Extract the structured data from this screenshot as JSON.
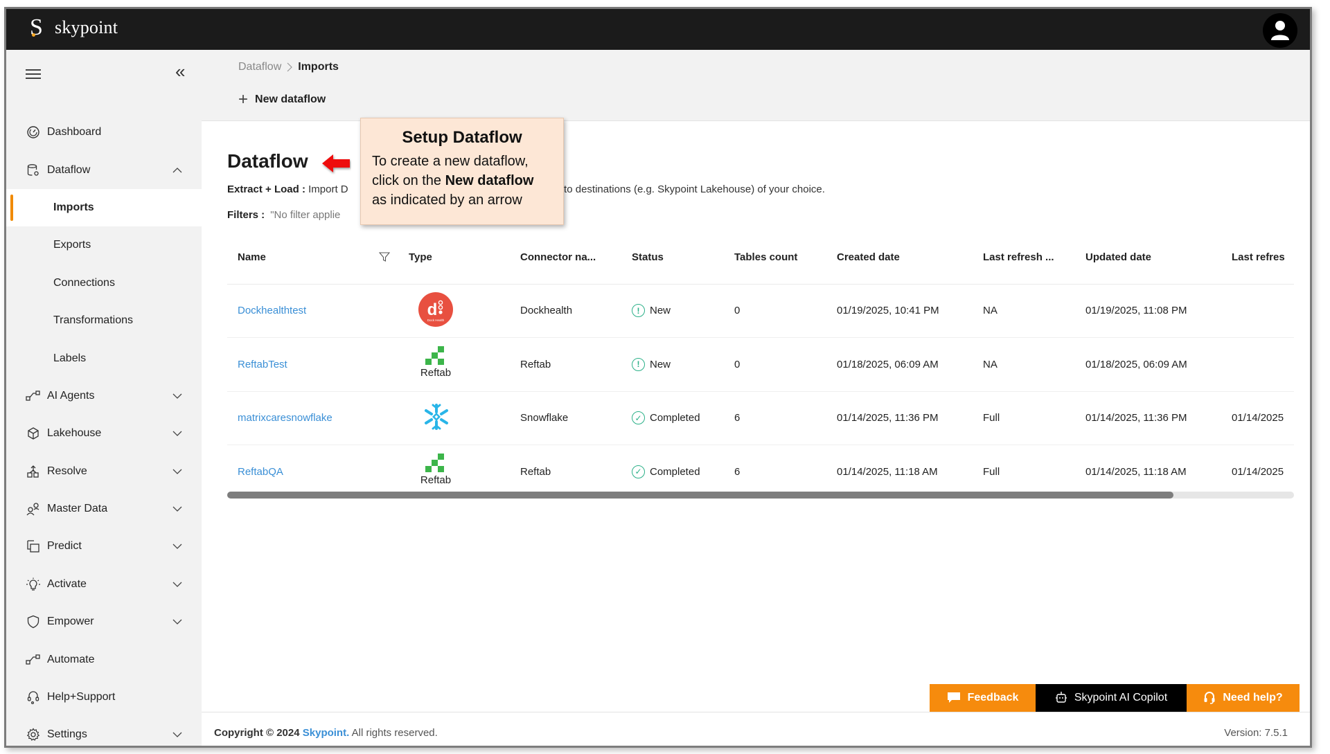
{
  "app": {
    "brand": "skypoint",
    "logo_letter": "S"
  },
  "colors": {
    "accent": "#f68b0d",
    "link": "#3a8fd6",
    "topbar": "#1b1b1b",
    "status_ok": "#2bb088",
    "callout_bg": "#fde7d6",
    "arrow": "#ee1111"
  },
  "sidebar": {
    "items": [
      {
        "label": "Dashboard",
        "icon": "gauge-icon",
        "expandable": false
      },
      {
        "label": "Dataflow",
        "icon": "database-gear-icon",
        "expandable": true,
        "expanded": true
      },
      {
        "label": "Imports",
        "sub": true,
        "active": true
      },
      {
        "label": "Exports",
        "sub": true
      },
      {
        "label": "Connections",
        "sub": true
      },
      {
        "label": "Transformations",
        "sub": true
      },
      {
        "label": "Labels",
        "sub": true
      },
      {
        "label": "AI Agents",
        "icon": "flow-icon",
        "expandable": true
      },
      {
        "label": "Lakehouse",
        "icon": "cube-icon",
        "expandable": true
      },
      {
        "label": "Resolve",
        "icon": "merge-icon",
        "expandable": true
      },
      {
        "label": "Master Data",
        "icon": "people-icon",
        "expandable": true
      },
      {
        "label": "Predict",
        "icon": "predict-icon",
        "expandable": true
      },
      {
        "label": "Activate",
        "icon": "lightbulb-icon",
        "expandable": true
      },
      {
        "label": "Empower",
        "icon": "shield-icon",
        "expandable": true
      },
      {
        "label": "Automate",
        "icon": "flow-icon",
        "expandable": false
      },
      {
        "label": "Help+Support",
        "icon": "headset-icon",
        "expandable": false
      },
      {
        "label": "Settings",
        "icon": "gear-icon",
        "expandable": true
      }
    ]
  },
  "breadcrumb": {
    "parent": "Dataflow",
    "separator": ">",
    "current": "Imports"
  },
  "toolbar": {
    "new_dataflow": "New dataflow"
  },
  "page": {
    "title": "Dataflow",
    "desc_label": "Extract + Load :",
    "desc_text_left": " Import D",
    "desc_text_right": "es and load into destinations (e.g. Skypoint Lakehouse) of your choice.",
    "filters_label": "Filters :",
    "filters_value": "\"No filter applie"
  },
  "callout": {
    "title": "Setup Dataflow",
    "line1": "To create a new dataflow,",
    "line2_pre": "click on the ",
    "line2_bold": "New dataflow",
    "line3": "as indicated by an arrow"
  },
  "table": {
    "columns": [
      "Name",
      "Type",
      "Connector na...",
      "Status",
      "Tables count",
      "Created date",
      "Last refresh ...",
      "Updated date",
      "Last refres"
    ],
    "rows": [
      {
        "name": "Dockhealthtest",
        "type": "dockhealth",
        "connector": "Dockhealth",
        "status": "New",
        "tables": "0",
        "created": "01/19/2025, 10:41 PM",
        "last_refresh_type": "NA",
        "updated": "01/19/2025, 11:08 PM",
        "last_refresh": ""
      },
      {
        "name": "ReftabTest",
        "type": "reftab",
        "connector": "Reftab",
        "status": "New",
        "tables": "0",
        "created": "01/18/2025, 06:09 AM",
        "last_refresh_type": "NA",
        "updated": "01/18/2025, 06:09 AM",
        "last_refresh": ""
      },
      {
        "name": "matrixcaresnowflake",
        "type": "snowflake",
        "connector": "Snowflake",
        "status": "Completed",
        "tables": "6",
        "created": "01/14/2025, 11:36 PM",
        "last_refresh_type": "Full",
        "updated": "01/14/2025, 11:36 PM",
        "last_refresh": "01/14/2025"
      },
      {
        "name": "ReftabQA",
        "type": "reftab",
        "connector": "Reftab",
        "status": "Completed",
        "tables": "6",
        "created": "01/14/2025, 11:18 AM",
        "last_refresh_type": "Full",
        "updated": "01/14/2025, 11:18 AM",
        "last_refresh": "01/14/2025"
      }
    ],
    "reftab_logo_text": "Reftab",
    "dockhealth_logo_text": "Dock Health",
    "horizontal_scroll_fraction": 0.887
  },
  "float_buttons": {
    "feedback": "Feedback",
    "copilot": "Skypoint AI Copilot",
    "help": "Need help?"
  },
  "footer": {
    "copyright_prefix": "Copyright © 2024 ",
    "brand": "Skypoint.",
    "suffix": " All rights reserved.",
    "version": "Version: 7.5.1"
  }
}
